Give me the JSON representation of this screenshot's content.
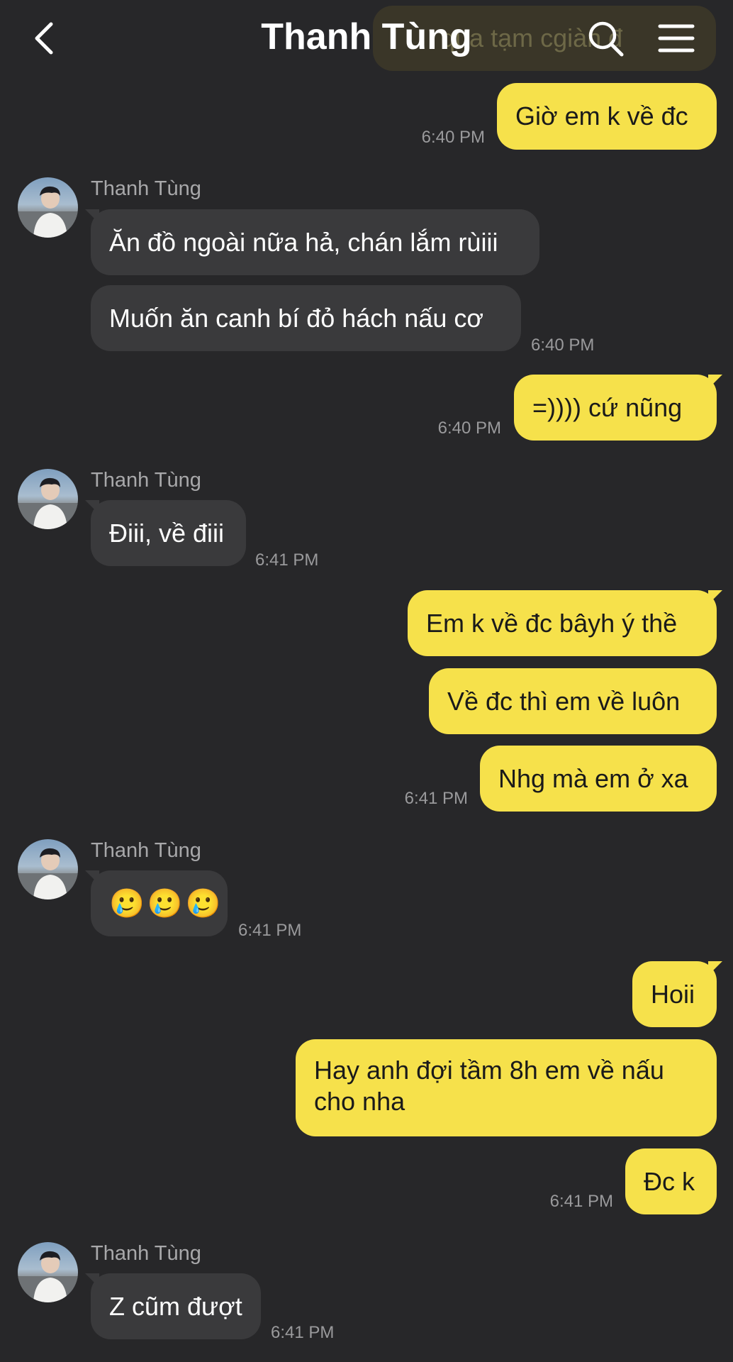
{
  "header": {
    "title": "Thanh Tùng"
  },
  "peek_message": "qua tạm cgiàn đ",
  "messages": [
    {
      "id": "m1",
      "from": "me",
      "text": "Giờ em k về đc",
      "time": "6:40 PM"
    },
    {
      "id": "m2",
      "from": "them",
      "sender": "Thanh Tùng",
      "text": "Ăn đồ ngoài nữa hả, chán lắm rùiii"
    },
    {
      "id": "m3",
      "from": "them",
      "text": "Muốn ăn canh bí đỏ hách nấu cơ",
      "time": "6:40 PM"
    },
    {
      "id": "m4",
      "from": "me",
      "text": "=)))) cứ nũng",
      "time": "6:40 PM"
    },
    {
      "id": "m5",
      "from": "them",
      "sender": "Thanh Tùng",
      "text": "Điii, về điii",
      "time": "6:41 PM"
    },
    {
      "id": "m6",
      "from": "me",
      "text": "Em k về đc bâyh ý thề"
    },
    {
      "id": "m7",
      "from": "me",
      "text": "Về đc thì em về luôn"
    },
    {
      "id": "m8",
      "from": "me",
      "text": "Nhg mà em ở xa",
      "time": "6:41 PM"
    },
    {
      "id": "m9",
      "from": "them",
      "sender": "Thanh Tùng",
      "text": "🥲🥲🥲",
      "time": "6:41 PM"
    },
    {
      "id": "m10",
      "from": "me",
      "text": "Hoii"
    },
    {
      "id": "m11",
      "from": "me",
      "text": "Hay anh đợi tầm 8h em về nấu cho nha"
    },
    {
      "id": "m12",
      "from": "me",
      "text": "Đc k",
      "time": "6:41 PM"
    },
    {
      "id": "m13",
      "from": "them",
      "sender": "Thanh Tùng",
      "text": "Z cũm đượt",
      "time": "6:41 PM"
    }
  ],
  "colors": {
    "background": "#272729",
    "outgoing_bubble": "#f6e14b",
    "incoming_bubble": "#3a3a3c",
    "timestamp": "#9a9a9c"
  },
  "icons": {
    "back": "chevron-left-icon",
    "search": "search-icon",
    "menu": "hamburger-menu-icon"
  }
}
